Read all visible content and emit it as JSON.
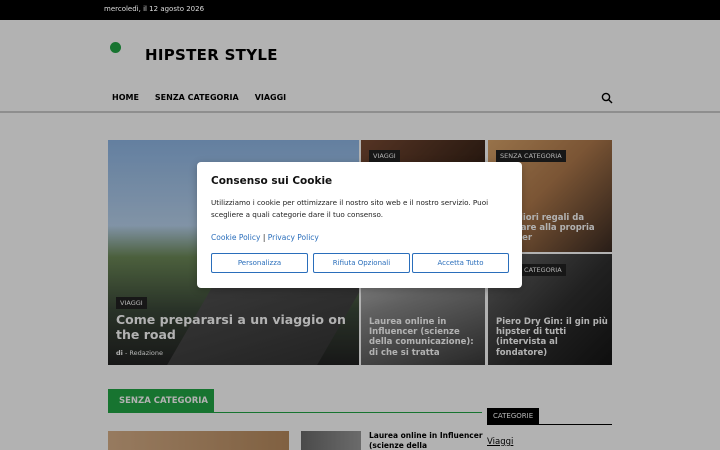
{
  "topbar": {
    "date": "mercoledì, il 12 agosto 2026"
  },
  "site": {
    "title": "HIPSTER STYLE",
    "accent_color": "#22a645"
  },
  "nav": {
    "items": [
      "HOME",
      "SENZA CATEGORIA",
      "VIAGGI"
    ]
  },
  "search": {
    "icon": "search-icon"
  },
  "featured": {
    "main": {
      "tag": "VIAGGI",
      "title": "Come prepararsi a un viaggio on the road",
      "author_prefix": "di",
      "author": "Redazione"
    },
    "top_middle": {
      "tag": "VIAGGI"
    },
    "top_right": {
      "tag": "SENZA CATEGORIA",
      "title": "I migliori regali da regalare alla propria partner"
    },
    "bottom_middle": {
      "title": "Laurea online in Influencer (scienze della comunicazione): di che si tratta"
    },
    "bottom_right": {
      "tag": "SENZA CATEGORIA",
      "title": "Piero Dry Gin: il gin più hipster di tutti (intervista al fondatore)"
    }
  },
  "section": {
    "title": "SENZA CATEGORIA",
    "article_title": "Laurea online in Influencer (scienze della"
  },
  "sidebar": {
    "title": "CATEGORIE",
    "link": "Viaggi"
  },
  "cookie": {
    "title": "Consenso sui Cookie",
    "message": "Utilizziamo i cookie per ottimizzare il nostro sito web e il nostro servizio. Puoi scegliere a quali categorie dare il tuo consenso.",
    "cookie_policy": "Cookie Policy",
    "separator": "|",
    "privacy_policy": "Privacy Policy",
    "buttons": {
      "customize": "Personalizza",
      "reject": "Rifiuta Opzionali",
      "accept": "Accetta Tutto"
    }
  }
}
